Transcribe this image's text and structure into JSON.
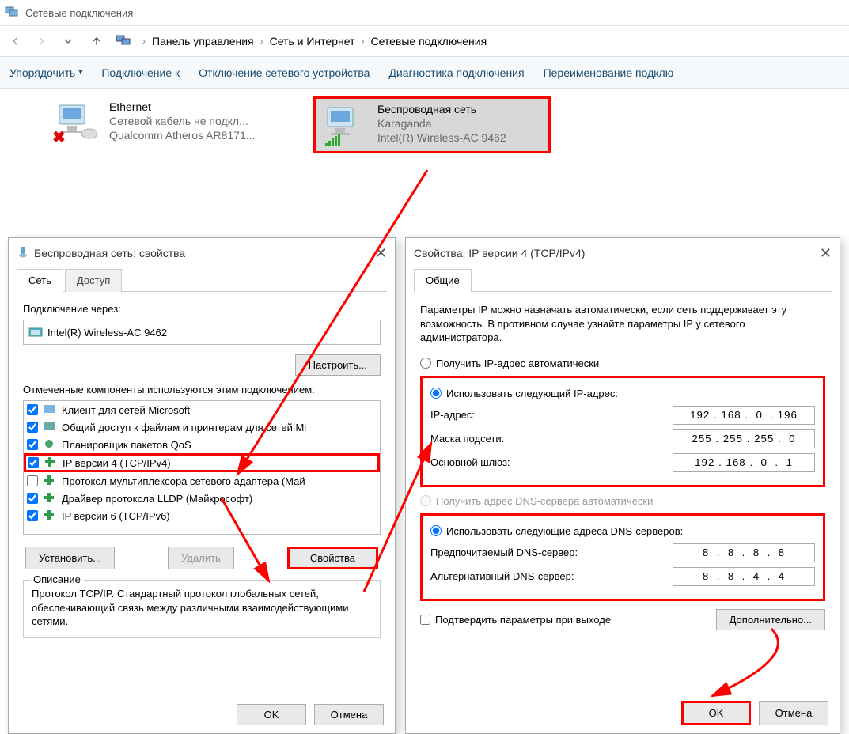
{
  "window_title": "Сетевые подключения",
  "breadcrumb": {
    "root": "Панель управления",
    "cat": "Сеть и Интернет",
    "leaf": "Сетевые подключения"
  },
  "toolbar": {
    "organize": "Упорядочить",
    "connect": "Подключение к",
    "disable": "Отключение сетевого устройства",
    "diag": "Диагностика подключения",
    "rename": "Переименование подклю"
  },
  "adapters": {
    "eth": {
      "name": "Ethernet",
      "status": "Сетевой кабель не подкл...",
      "device": "Qualcomm Atheros AR8171..."
    },
    "wifi": {
      "name": "Беспроводная сеть",
      "status": "Karaganda",
      "device": "Intel(R) Wireless-AC 9462"
    }
  },
  "dlg1": {
    "title": "Беспроводная сеть: свойства",
    "tab_net": "Сеть",
    "tab_access": "Доступ",
    "connect_via_label": "Подключение через:",
    "connect_via_value": "Intel(R) Wireless-AC 9462",
    "configure_btn": "Настроить...",
    "components_label": "Отмеченные компоненты используются этим подключением:",
    "components": [
      "Клиент для сетей Microsoft",
      "Общий доступ к файлам и принтерам для сетей Mi",
      "Планировщик пакетов QoS",
      "IP версии 4 (TCP/IPv4)",
      "Протокол мультиплексора сетевого адаптера (Май",
      "Драйвер протокола LLDP (Майкрософт)",
      "IP версии 6 (TCP/IPv6)"
    ],
    "install_btn": "Установить...",
    "remove_btn": "Удалить",
    "props_btn": "Свойства",
    "desc_title": "Описание",
    "desc_text": "Протокол TCP/IP. Стандартный протокол глобальных сетей, обеспечивающий связь между различными взаимодействующими сетями.",
    "ok": "OK",
    "cancel": "Отмена"
  },
  "dlg2": {
    "title": "Свойства: IP версии 4 (TCP/IPv4)",
    "tab_general": "Общие",
    "intro": "Параметры IP можно назначать автоматически, если сеть поддерживает эту возможность. В противном случае узнайте параметры IP у сетевого администратора.",
    "radio_ip_auto": "Получить IP-адрес автоматически",
    "radio_ip_manual": "Использовать следующий IP-адрес:",
    "ip_label": "IP-адрес:",
    "ip_value": "192 . 168 .  0  . 196",
    "mask_label": "Маска подсети:",
    "mask_value": "255 . 255 . 255 .  0",
    "gw_label": "Основной шлюз:",
    "gw_value": "192 . 168 .  0  .  1",
    "radio_dns_auto": "Получить адрес DNS-сервера автоматически",
    "radio_dns_manual": "Использовать следующие адреса DNS-серверов:",
    "dns1_label": "Предпочитаемый DNS-сервер:",
    "dns1_value": "8  .  8  .  8  .  8",
    "dns2_label": "Альтернативный DNS-сервер:",
    "dns2_value": "8  .  8  .  4  .  4",
    "confirm_on_exit": "Подтвердить параметры при выходе",
    "advanced_btn": "Дополнительно...",
    "ok": "OK",
    "cancel": "Отмена"
  }
}
